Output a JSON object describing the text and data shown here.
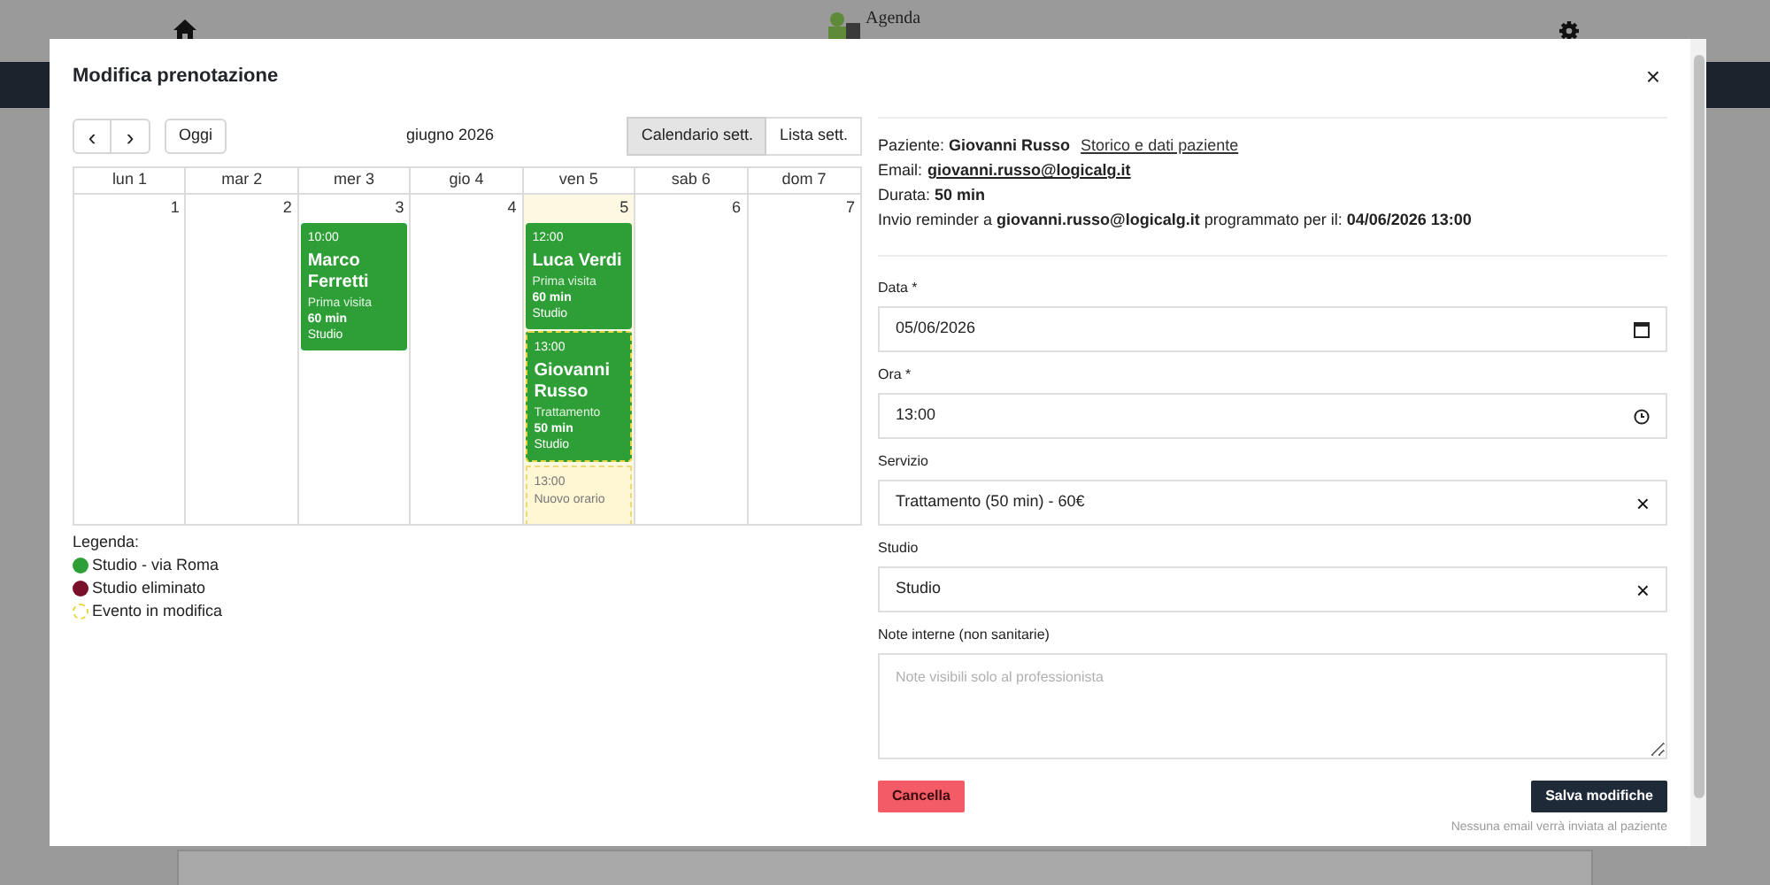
{
  "background": {
    "brand": "Agenda"
  },
  "modal": {
    "title": "Modifica prenotazione",
    "close": "×"
  },
  "calendar": {
    "prev": "‹",
    "next": "›",
    "today_button": "Oggi",
    "period": "giugno 2026",
    "views": [
      {
        "label": "Calendario sett.",
        "selected": true
      },
      {
        "label": "Lista sett.",
        "selected": false
      }
    ],
    "days": [
      {
        "header": "lun 1",
        "number": "1",
        "today": false
      },
      {
        "header": "mar 2",
        "number": "2",
        "today": false
      },
      {
        "header": "mer 3",
        "number": "3",
        "today": false,
        "events": [
          {
            "kind": "booking",
            "color": "#2e9e36",
            "time": "10:00",
            "name": "Marco Ferretti",
            "service": "Prima visita",
            "duration": "60 min",
            "place": "Studio"
          }
        ]
      },
      {
        "header": "gio 4",
        "number": "4",
        "today": false
      },
      {
        "header": "ven 5",
        "number": "5",
        "today": true,
        "events": [
          {
            "kind": "booking",
            "color": "#2e9e36",
            "time": "12:00",
            "name": "Luca Verdi",
            "service": "Prima visita",
            "duration": "60 min",
            "place": "Studio"
          },
          {
            "kind": "editing",
            "color": "#2e9e36",
            "time": "13:00",
            "name": "Giovanni Russo",
            "service": "Trattamento",
            "duration": "50 min",
            "place": "Studio"
          },
          {
            "kind": "new_slot",
            "time": "13:00",
            "label": "Nuovo orario"
          }
        ]
      },
      {
        "header": "sab 6",
        "number": "6",
        "today": false
      },
      {
        "header": "dom 7",
        "number": "7",
        "today": false
      }
    ]
  },
  "legend": {
    "title": "Legenda:",
    "items": [
      {
        "kind": "dot",
        "color": "#2e9e36",
        "label": "Studio - via Roma"
      },
      {
        "kind": "dot",
        "color": "#7a0f2a",
        "label": "Studio eliminato"
      },
      {
        "kind": "dashed",
        "label": "Evento in modifica"
      }
    ]
  },
  "patient": {
    "line_1": "Paziente: **Giovanni Russo**",
    "history_link": "Storico e dati paziente",
    "email_label": "Email:",
    "email": "giovanni.russo@logicalg.it",
    "duration": "Durata: **50 min**",
    "reminder": "Invio reminder a **giovanni.russo@logicalg.it** programmato per il: **04/06/2026 13:00**"
  },
  "form": {
    "fields": [
      {
        "kind": "date",
        "label": "Data *",
        "value": "05/06/2026"
      },
      {
        "kind": "time",
        "label": "Ora *",
        "value": "13:00"
      },
      {
        "kind": "select",
        "label": "Servizio",
        "value": "Trattamento (50 min) - 60€",
        "clear": "×"
      },
      {
        "kind": "select",
        "label": "Studio",
        "value": "Studio",
        "clear": "×"
      },
      {
        "kind": "textarea",
        "label": "Note interne (non sanitarie)",
        "placeholder": "Note visibili solo al professionista"
      }
    ],
    "cancel": "Cancella",
    "save": "Salva modifiche",
    "note": "Nessuna email verrà inviata al paziente"
  }
}
